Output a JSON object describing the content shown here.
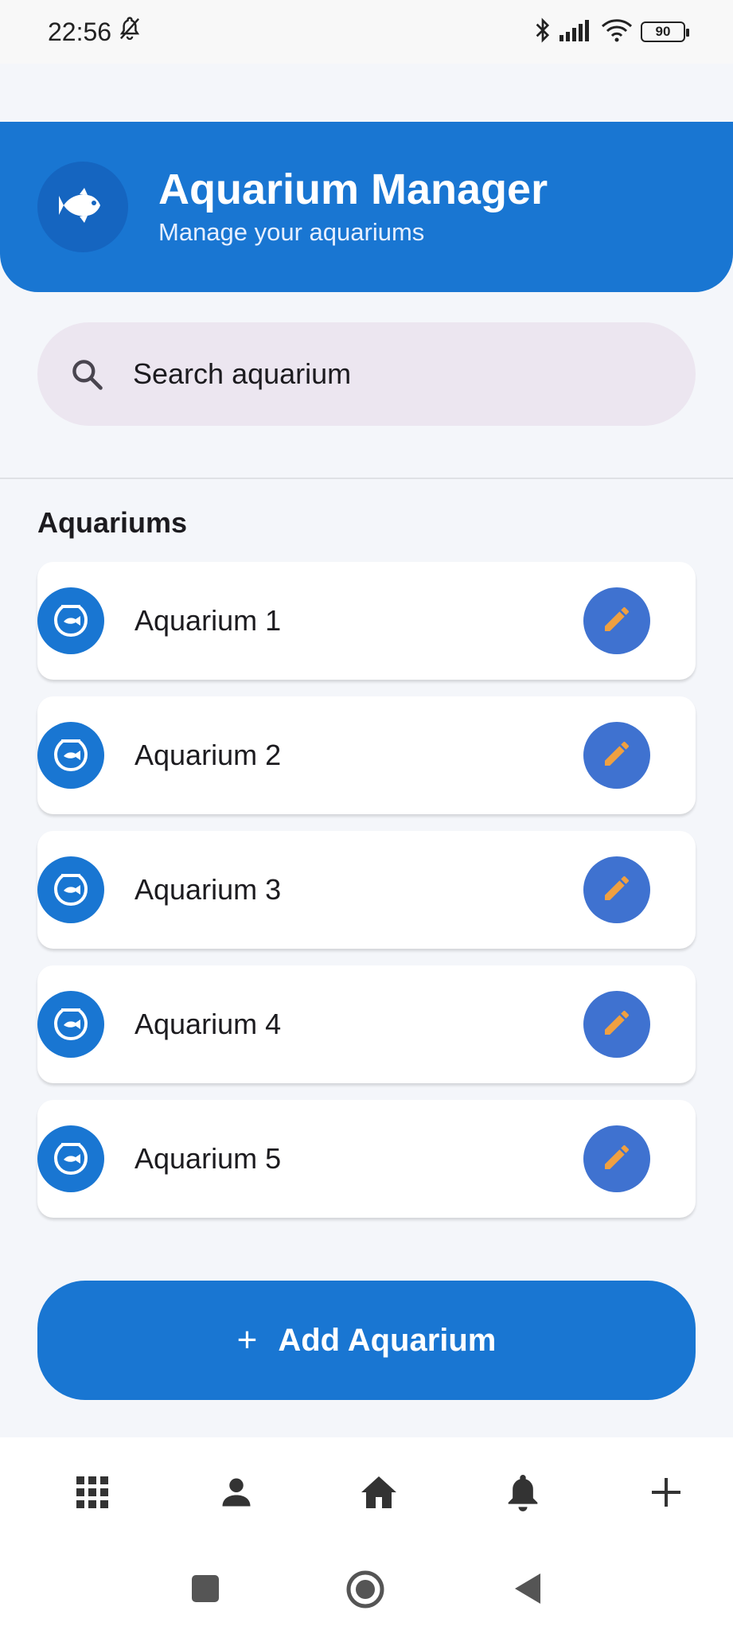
{
  "status_bar": {
    "time": "22:56",
    "battery": "90",
    "icons": [
      "bell-off-icon",
      "bluetooth-icon",
      "signal-icon",
      "wifi-icon",
      "battery-icon"
    ]
  },
  "header": {
    "title": "Aquarium Manager",
    "subtitle": "Manage your aquariums",
    "icon": "fish-icon"
  },
  "search": {
    "placeholder": "Search aquarium",
    "icon": "search-icon"
  },
  "section": {
    "title": "Aquariums"
  },
  "aquariums": [
    {
      "label": "Aquarium 1"
    },
    {
      "label": "Aquarium 2"
    },
    {
      "label": "Aquarium 3"
    },
    {
      "label": "Aquarium 4"
    },
    {
      "label": "Aquarium 5"
    }
  ],
  "add_button": {
    "icon": "+",
    "label": "Add Aquarium"
  },
  "bottom_nav": [
    "grid-icon",
    "person-icon",
    "home-icon",
    "bell-icon",
    "plus-icon"
  ],
  "colors": {
    "primary": "#1976d2",
    "edit_button": "#3f72d0",
    "edit_icon": "#f0a040",
    "search_bg": "#ece6f0",
    "page_bg": "#f4f6fa"
  }
}
